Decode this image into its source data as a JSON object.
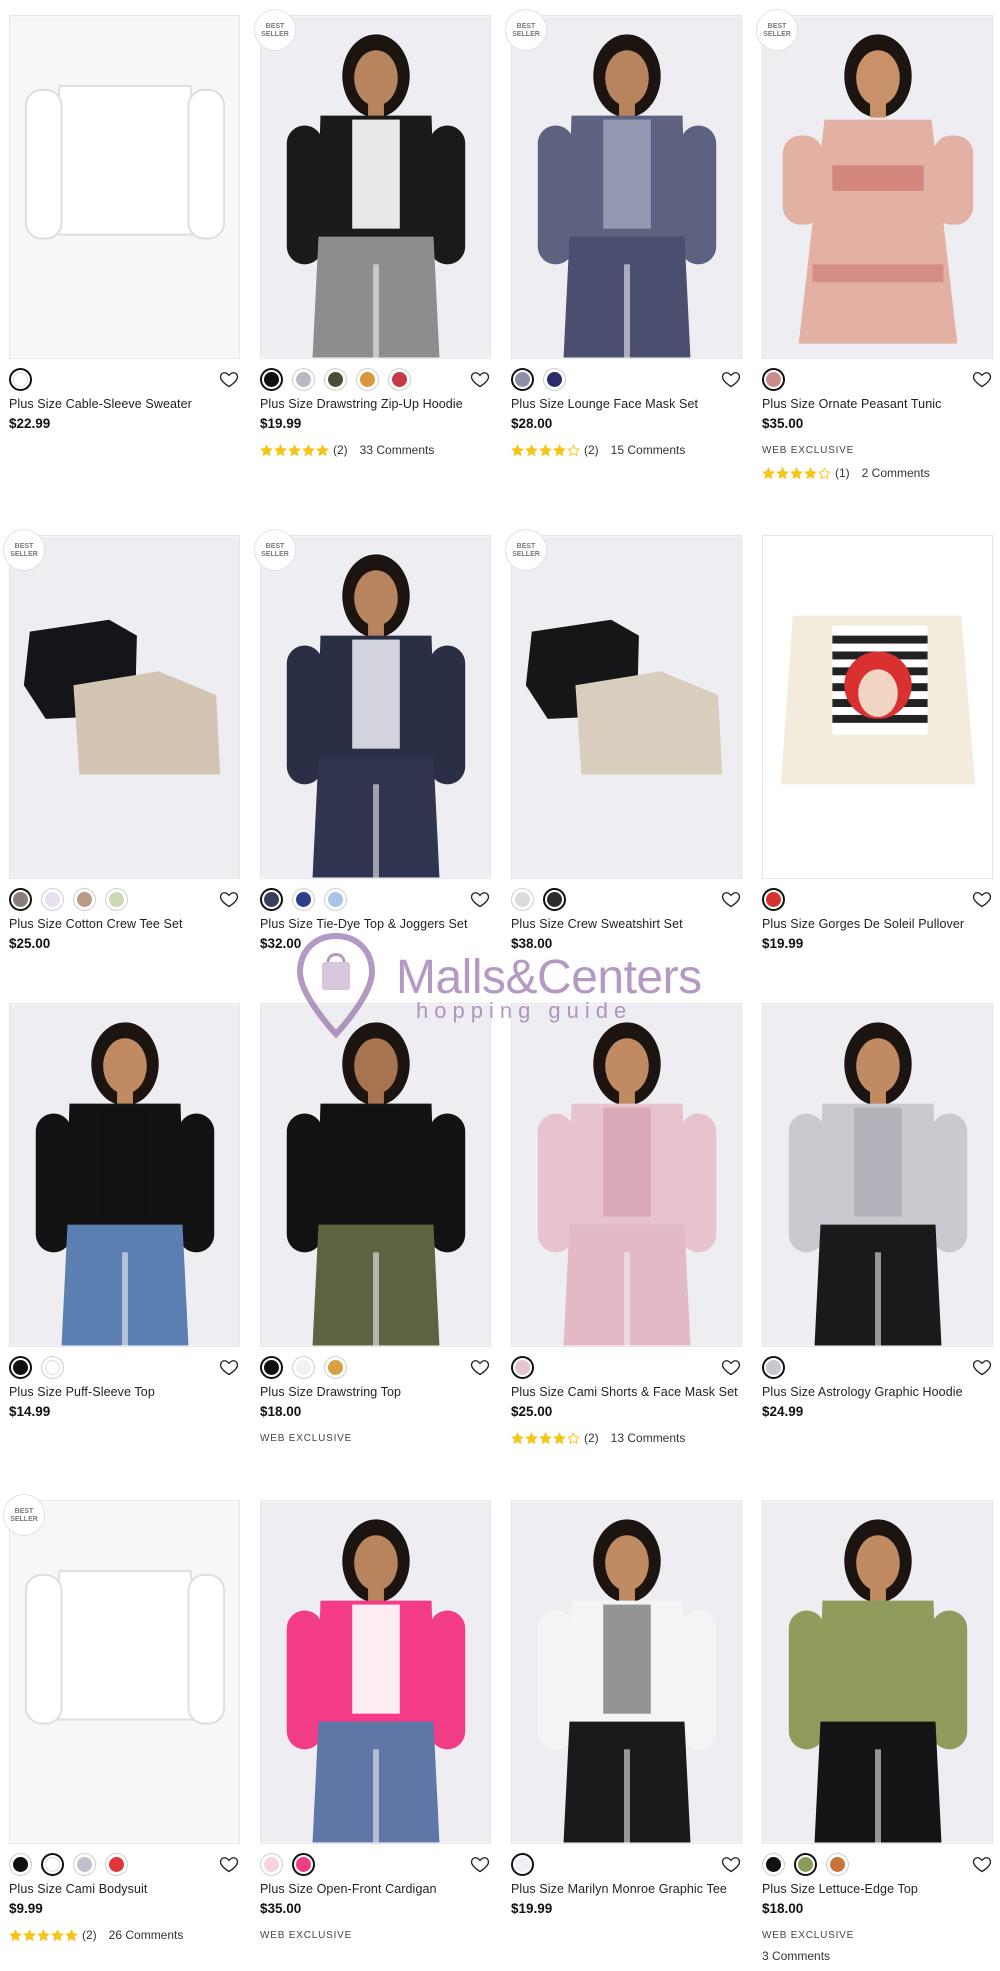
{
  "badges": {
    "best_seller": "BEST SELLER"
  },
  "watermark": {
    "title": "Malls&Centers",
    "subtitle": "hopping guide"
  },
  "labels": {
    "web_exclusive": "WEB EXCLUSIVE"
  },
  "products": [
    {
      "name": "Plus Size Cable-Sleeve Sweater",
      "price": "$22.99",
      "best": false,
      "swatches": [
        "#ffffff"
      ],
      "selected": 0
    },
    {
      "name": "Plus Size Drawstring Zip-Up Hoodie",
      "price": "$19.99",
      "best": true,
      "swatches": [
        "#111111",
        "#b9b9c2",
        "#4a4f38",
        "#d9963a",
        "#c43a46"
      ],
      "selected": 0,
      "rating": {
        "stars": 5,
        "count": "(2)",
        "comments": "33 Comments"
      }
    },
    {
      "name": "Plus Size Lounge Face Mask Set",
      "price": "$28.00",
      "best": true,
      "swatches": [
        "#8d8fa8",
        "#2a2d6a"
      ],
      "selected": 0,
      "rating": {
        "stars": 4,
        "count": "(2)",
        "comments": "15 Comments"
      }
    },
    {
      "name": "Plus Size Ornate Peasant Tunic",
      "price": "$35.00",
      "best": true,
      "swatches": [
        "#c98a8a"
      ],
      "selected": 0,
      "web_exclusive": true,
      "rating": {
        "stars": 4,
        "count": "(1)",
        "comments": "2 Comments"
      }
    },
    {
      "name": "Plus Size Cotton Crew Tee Set",
      "price": "$25.00",
      "best": true,
      "swatches": [
        "#8a7f78",
        "#e9dff0",
        "#b89a86",
        "#c9d9b8"
      ],
      "selected": 0
    },
    {
      "name": "Plus Size Tie-Dye Top & Joggers Set",
      "price": "$32.00",
      "best": true,
      "swatches": [
        "#3a3f5c",
        "#2f3e8a",
        "#a8c4e8"
      ],
      "selected": 0
    },
    {
      "name": "Plus Size Crew Sweatshirt Set",
      "price": "$38.00",
      "best": true,
      "swatches": [
        "#dcdcdc",
        "#2b2b2b"
      ],
      "selected": 1
    },
    {
      "name": "Plus Size Gorges De Soleil Pullover",
      "price": "$19.99",
      "best": false,
      "swatches": [
        "#d8302f"
      ],
      "selected": 0
    },
    {
      "name": "Plus Size Puff-Sleeve Top",
      "price": "$14.99",
      "best": false,
      "swatches": [
        "#111111",
        "#ffffff"
      ],
      "selected": 0
    },
    {
      "name": "Plus Size Drawstring Top",
      "price": "$18.00",
      "best": false,
      "swatches": [
        "#111111",
        "#f2f2f2",
        "#d8a040"
      ],
      "selected": 0,
      "web_exclusive": true
    },
    {
      "name": "Plus Size Cami Shorts & Face Mask Set",
      "price": "$25.00",
      "best": false,
      "swatches": [
        "#e6c6cf"
      ],
      "selected": 0,
      "rating": {
        "stars": 4,
        "count": "(2)",
        "comments": "13 Comments"
      }
    },
    {
      "name": "Plus Size Astrology Graphic Hoodie",
      "price": "$24.99",
      "best": false,
      "swatches": [
        "#c8c8d0"
      ],
      "selected": 0
    },
    {
      "name": "Plus Size Cami Bodysuit",
      "price": "$9.99",
      "best": true,
      "swatches": [
        "#111111",
        "#ffffff",
        "#c0c0cc",
        "#e0353c"
      ],
      "selected": 1,
      "rating": {
        "stars": 5,
        "count": "(2)",
        "comments": "26 Comments"
      }
    },
    {
      "name": "Plus Size Open-Front Cardigan",
      "price": "$35.00",
      "best": false,
      "swatches": [
        "#f6d3df",
        "#ee3f84"
      ],
      "selected": 1,
      "web_exclusive": true
    },
    {
      "name": "Plus Size Marilyn Monroe Graphic Tee",
      "price": "$19.99",
      "best": false,
      "swatches": [
        "#eef0f6"
      ],
      "selected": 0
    },
    {
      "name": "Plus Size Lettuce-Edge Top",
      "price": "$18.00",
      "best": false,
      "swatches": [
        "#111111",
        "#8a9a5b",
        "#c8743c"
      ],
      "selected": 1,
      "web_exclusive": true,
      "only_comments": "3 Comments"
    }
  ]
}
